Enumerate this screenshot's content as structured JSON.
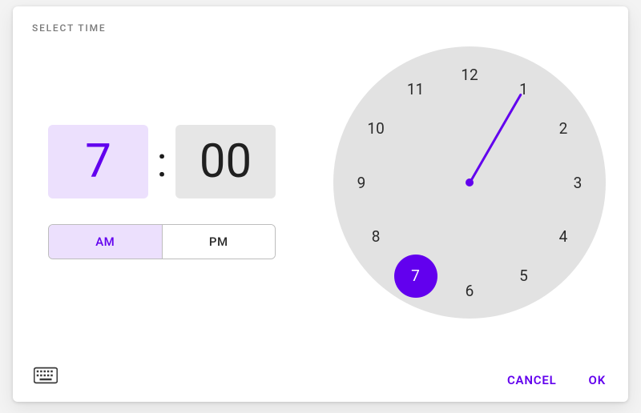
{
  "title": "SELECT TIME",
  "time": {
    "hour": "7",
    "minute": "00",
    "separator": ":"
  },
  "ampm": {
    "am_label": "AM",
    "pm_label": "PM",
    "selected": "AM"
  },
  "clock": {
    "numbers": [
      "12",
      "1",
      "2",
      "3",
      "4",
      "5",
      "6",
      "7",
      "8",
      "9",
      "10",
      "11"
    ],
    "selected_hour": 7
  },
  "actions": {
    "cancel": "CANCEL",
    "ok": "OK"
  },
  "colors": {
    "accent": "#6200ee",
    "accent_light": "#ece0fd",
    "dial_bg": "#e2e2e2",
    "neutral_box": "#e6e6e6"
  }
}
